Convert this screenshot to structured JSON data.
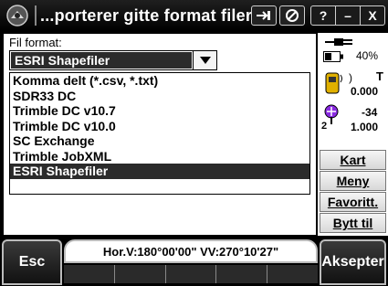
{
  "window": {
    "title": "...porterer gitte format filer",
    "buttons": {
      "help": "?",
      "minimize": "–",
      "close": "X"
    }
  },
  "form": {
    "field_label": "Fil format:",
    "selected_value": "ESRI Shapefiler",
    "options": [
      "Komma delt (*.csv, *.txt)",
      "SDR33 DC",
      "Trimble DC v10.7",
      "Trimble DC v10.0",
      "SC Exchange",
      "Trimble JobXML",
      "ESRI Shapefiler"
    ],
    "selected_index": 6
  },
  "status": {
    "battery_percent": "40%",
    "receiver_letter": "T",
    "receiver_value": "0.000",
    "prism_value": "-34",
    "prism_index": "2",
    "prism_constant": "1.000"
  },
  "side_buttons": {
    "kart": "Kart",
    "meny": "Meny",
    "favoritt": "Favoritt.",
    "bytt": "Bytt til"
  },
  "bottom": {
    "esc_label": "Esc",
    "accept_label": "Aksepter",
    "angles_text": "Hor.V:180°00'00\"  VV:270°10'27\""
  },
  "colors": {
    "selection_bg": "#2b2b2b",
    "titlebar_bg": "#000000"
  }
}
